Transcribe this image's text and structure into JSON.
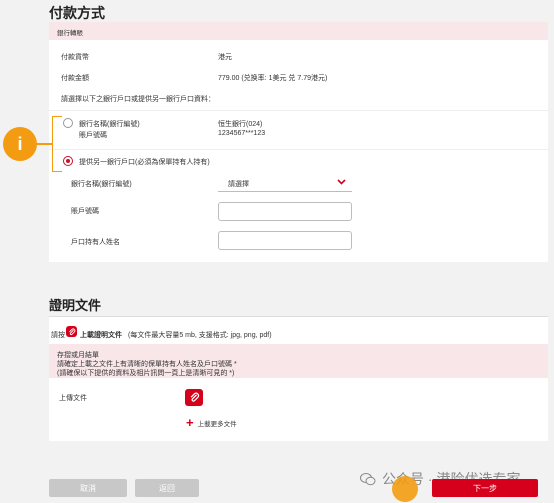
{
  "payment": {
    "title": "付款方式",
    "bank_transfer": "銀行轉賬",
    "currency_label": "付款貨幣",
    "currency_value": "港元",
    "amount_label": "付款金額",
    "amount_value": "779.00 (兑换率: 1美元 兑 7.79港元)",
    "instruction": "請選擇以下之銀行戶口或提供另一銀行戶口資料：",
    "option1": {
      "bank_label": "銀行名稱(銀行編號)",
      "account_label": "賬戶號碼",
      "bank_value": "恒生銀行(024)",
      "account_value": "1234567***123"
    },
    "option2_label": "提供另一銀行戶口(必須為保單持有人持有)",
    "form": {
      "bank_label": "銀行名稱(銀行編號)",
      "select_value": "請選擇",
      "account_label": "賬戶號碼",
      "holder_label": "戶口持有人姓名"
    },
    "info_icon": "i"
  },
  "proof": {
    "title": "證明文件",
    "upload_prefix": "請按",
    "upload_link": "上載證明文件",
    "upload_hint": "(每文件最大容量5 mb, 支援格式: jpg, png, pdf)",
    "notice_title": "存摺或月結單",
    "notice_line1": "請確定上載之文件上有清晰的保單持有人姓名及戶口號碼 *",
    "notice_line2": "(請確保以下提供的資料及相片訊問一頁上是清晰可見的 *)",
    "upload_file_label": "上傳文件",
    "upload_more": "上載更多文件"
  },
  "footer": {
    "cancel": "取消",
    "back": "返回",
    "next": "下一步",
    "watermark": "公众号 · 港险优选专家"
  },
  "colors": {
    "accent": "#d7001c",
    "info_orange": "#f39c12",
    "pink_bg": "#f8e6e9"
  },
  "icons": {
    "clip": "paperclip-icon",
    "plus": "plus-icon",
    "chevron": "chevron-down-icon",
    "wechat": "wechat-icon"
  }
}
